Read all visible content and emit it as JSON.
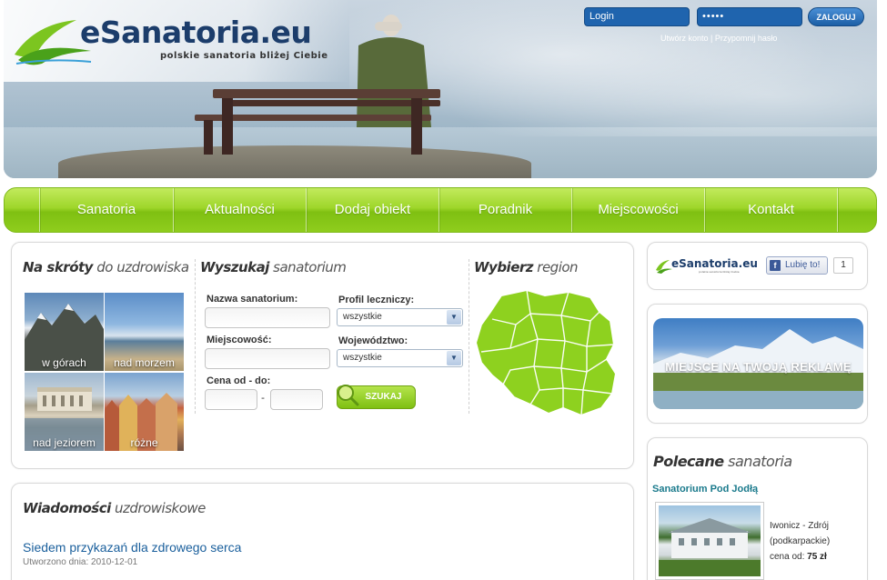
{
  "brand": {
    "name": "eSanatoria.eu",
    "tagline": "polskie sanatoria bliżej Ciebie"
  },
  "login": {
    "login_value": "Login",
    "password_value": "•••••",
    "submit_label": "ZALOGUJ",
    "create_account": "Utwórz konto",
    "separator": "|",
    "forgot_password": "Przypomnij hasło"
  },
  "nav": {
    "items": [
      "Sanatoria",
      "Aktualności",
      "Dodaj obiekt",
      "Poradnik",
      "Miejscowości",
      "Kontakt"
    ]
  },
  "shortcuts": {
    "title_bold": "Na skróty",
    "title_rest": " do uzdrowiska",
    "tiles": [
      "w górach",
      "nad morzem",
      "nad jeziorem",
      "różne"
    ]
  },
  "search": {
    "title_bold": "Wyszukaj",
    "title_rest": " sanatorium",
    "name_label": "Nazwa sanatorium:",
    "town_label": "Miejscowość:",
    "price_label": "Cena od - do:",
    "price_dash": "-",
    "profile_label": "Profil leczniczy:",
    "profile_value": "wszystkie",
    "province_label": "Województwo:",
    "province_value": "wszystkie",
    "submit_label": "SZUKAJ"
  },
  "region": {
    "title_bold": "Wybierz",
    "title_rest": " region"
  },
  "news": {
    "title_bold": "Wiadomości",
    "title_rest": " uzdrowiskowe",
    "headline": "Siedem przykazań dla zdrowego serca",
    "created": "Utworzono dnia: 2010-12-01"
  },
  "social": {
    "like_label": "Lubię to!",
    "like_count": "1",
    "fb_glyph": "f"
  },
  "ad": {
    "text": "MIEJSCE NA TWOJĄ REKLAMĘ"
  },
  "recommended": {
    "title_bold": "Polecane",
    "title_rest": " sanatoria",
    "name": "Sanatorium Pod Jodłą",
    "town": "Iwonicz - Zdrój",
    "province": "(podkarpackie)",
    "price_label": "cena od:",
    "price_value": "75 zł"
  },
  "icons": {
    "select_arrow": "▼",
    "search": "magnifier-icon",
    "facebook": "facebook-icon"
  },
  "colors": {
    "nav_green": "#8fcd1d",
    "brand_blue": "#1c3d6b",
    "login_blue": "#1f64ae",
    "link_blue": "#1a5f9c"
  }
}
